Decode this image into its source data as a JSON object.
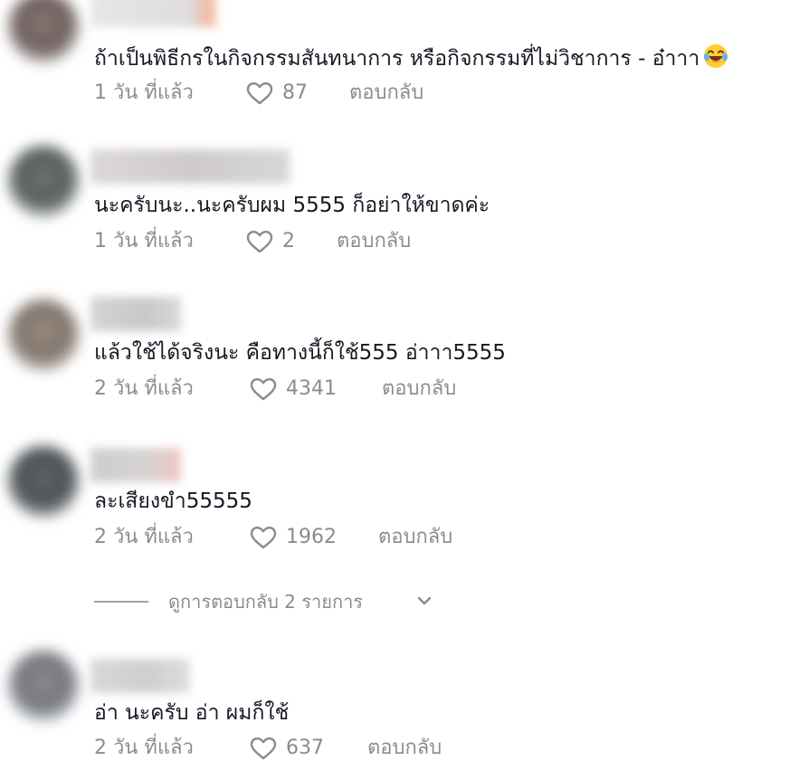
{
  "comments": [
    {
      "text": "ถ้าเป็นพิธีกรในกิจกรรมสันทนาการ หรือกิจกรรมที่ไม่วิชาการ - อ๋าาา",
      "emoji": "laughing-tears-emoji",
      "time": "1 วัน ที่แล้ว",
      "likes": "87",
      "reply": "ตอบกลับ"
    },
    {
      "text": "นะครับนะ..นะครับผม 5555 ก็อย่าให้ขาดค่ะ",
      "time": "1 วัน ที่แล้ว",
      "likes": "2",
      "reply": "ตอบกลับ"
    },
    {
      "text": "แล้วใช้ได้จริงนะ คือทางนี้ก็ใช้555 อ่าาา5555",
      "time": "2 วัน ที่แล้ว",
      "likes": "4341",
      "reply": "ตอบกลับ"
    },
    {
      "text": "ละเสียงขำ55555",
      "time": "2 วัน ที่แล้ว",
      "likes": "1962",
      "reply": "ตอบกลับ"
    },
    {
      "text": "อ่า นะครับ อ่า ผมก็ใช้",
      "time": "2 วัน ที่แล้ว",
      "likes": "637",
      "reply": "ตอบกลับ"
    }
  ],
  "view_replies": {
    "label": "ดูการตอบกลับ 2 รายการ"
  },
  "icons": {
    "like": "heart-outline-icon",
    "expand": "chevron-down-icon"
  },
  "colors": {
    "text": "#161823",
    "secondary": "#8a8b91"
  }
}
